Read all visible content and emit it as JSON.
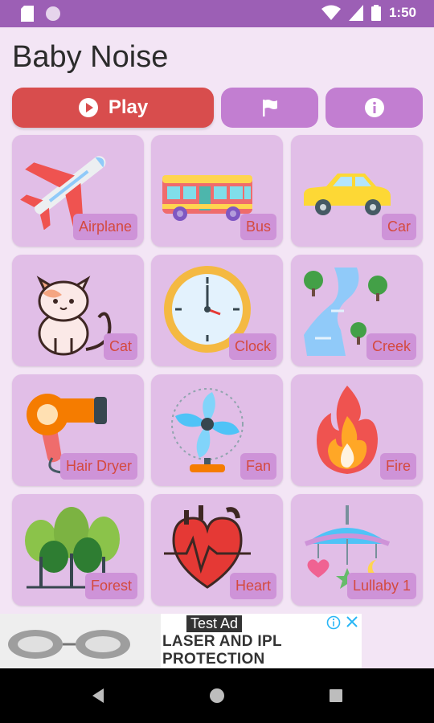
{
  "status_bar": {
    "time": "1:50"
  },
  "app": {
    "title": "Baby Noise"
  },
  "toolbar": {
    "play_label": "Play"
  },
  "tiles": [
    {
      "label": "Airplane",
      "icon": "airplane-icon"
    },
    {
      "label": "Bus",
      "icon": "bus-icon"
    },
    {
      "label": "Car",
      "icon": "car-icon"
    },
    {
      "label": "Cat",
      "icon": "cat-icon"
    },
    {
      "label": "Clock",
      "icon": "clock-icon"
    },
    {
      "label": "Creek",
      "icon": "creek-icon"
    },
    {
      "label": "Hair Dryer",
      "icon": "hair-dryer-icon"
    },
    {
      "label": "Fan",
      "icon": "fan-icon"
    },
    {
      "label": "Fire",
      "icon": "fire-icon"
    },
    {
      "label": "Forest",
      "icon": "forest-icon"
    },
    {
      "label": "Heart",
      "icon": "heart-icon"
    },
    {
      "label": "Lullaby 1",
      "icon": "lullaby-mobile-icon"
    }
  ],
  "ad": {
    "tag": "Test Ad",
    "text": "LASER AND IPL PROTECTION"
  },
  "colors": {
    "status_bar": "#9c5fb5",
    "play_button": "#d84d4d",
    "action_button": "#c27ed1",
    "tile": "#e1bee7",
    "label_bg": "#ce93d8",
    "label_text": "#d44a3f"
  }
}
